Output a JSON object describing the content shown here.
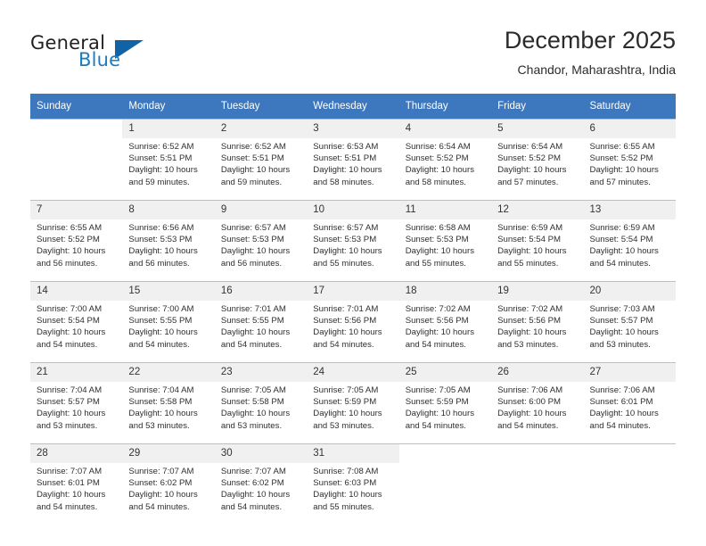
{
  "brand": {
    "name_top": "General",
    "name_bottom": "Blue",
    "accent_color": "#1263a5",
    "text_color": "#231f20"
  },
  "header": {
    "title": "December 2025",
    "location": "Chandor, Maharashtra, India"
  },
  "calendar": {
    "header_bg": "#3d78be",
    "daynum_bg": "#f0f0f0",
    "weekdays": [
      "Sunday",
      "Monday",
      "Tuesday",
      "Wednesday",
      "Thursday",
      "Friday",
      "Saturday"
    ],
    "weeks": [
      [
        {
          "day": "",
          "blank": true,
          "lines": []
        },
        {
          "day": "1",
          "lines": [
            "Sunrise: 6:52 AM",
            "Sunset: 5:51 PM",
            "Daylight: 10 hours",
            "and 59 minutes."
          ]
        },
        {
          "day": "2",
          "lines": [
            "Sunrise: 6:52 AM",
            "Sunset: 5:51 PM",
            "Daylight: 10 hours",
            "and 59 minutes."
          ]
        },
        {
          "day": "3",
          "lines": [
            "Sunrise: 6:53 AM",
            "Sunset: 5:51 PM",
            "Daylight: 10 hours",
            "and 58 minutes."
          ]
        },
        {
          "day": "4",
          "lines": [
            "Sunrise: 6:54 AM",
            "Sunset: 5:52 PM",
            "Daylight: 10 hours",
            "and 58 minutes."
          ]
        },
        {
          "day": "5",
          "lines": [
            "Sunrise: 6:54 AM",
            "Sunset: 5:52 PM",
            "Daylight: 10 hours",
            "and 57 minutes."
          ]
        },
        {
          "day": "6",
          "lines": [
            "Sunrise: 6:55 AM",
            "Sunset: 5:52 PM",
            "Daylight: 10 hours",
            "and 57 minutes."
          ]
        }
      ],
      [
        {
          "day": "7",
          "lines": [
            "Sunrise: 6:55 AM",
            "Sunset: 5:52 PM",
            "Daylight: 10 hours",
            "and 56 minutes."
          ]
        },
        {
          "day": "8",
          "lines": [
            "Sunrise: 6:56 AM",
            "Sunset: 5:53 PM",
            "Daylight: 10 hours",
            "and 56 minutes."
          ]
        },
        {
          "day": "9",
          "lines": [
            "Sunrise: 6:57 AM",
            "Sunset: 5:53 PM",
            "Daylight: 10 hours",
            "and 56 minutes."
          ]
        },
        {
          "day": "10",
          "lines": [
            "Sunrise: 6:57 AM",
            "Sunset: 5:53 PM",
            "Daylight: 10 hours",
            "and 55 minutes."
          ]
        },
        {
          "day": "11",
          "lines": [
            "Sunrise: 6:58 AM",
            "Sunset: 5:53 PM",
            "Daylight: 10 hours",
            "and 55 minutes."
          ]
        },
        {
          "day": "12",
          "lines": [
            "Sunrise: 6:59 AM",
            "Sunset: 5:54 PM",
            "Daylight: 10 hours",
            "and 55 minutes."
          ]
        },
        {
          "day": "13",
          "lines": [
            "Sunrise: 6:59 AM",
            "Sunset: 5:54 PM",
            "Daylight: 10 hours",
            "and 54 minutes."
          ]
        }
      ],
      [
        {
          "day": "14",
          "lines": [
            "Sunrise: 7:00 AM",
            "Sunset: 5:54 PM",
            "Daylight: 10 hours",
            "and 54 minutes."
          ]
        },
        {
          "day": "15",
          "lines": [
            "Sunrise: 7:00 AM",
            "Sunset: 5:55 PM",
            "Daylight: 10 hours",
            "and 54 minutes."
          ]
        },
        {
          "day": "16",
          "lines": [
            "Sunrise: 7:01 AM",
            "Sunset: 5:55 PM",
            "Daylight: 10 hours",
            "and 54 minutes."
          ]
        },
        {
          "day": "17",
          "lines": [
            "Sunrise: 7:01 AM",
            "Sunset: 5:56 PM",
            "Daylight: 10 hours",
            "and 54 minutes."
          ]
        },
        {
          "day": "18",
          "lines": [
            "Sunrise: 7:02 AM",
            "Sunset: 5:56 PM",
            "Daylight: 10 hours",
            "and 54 minutes."
          ]
        },
        {
          "day": "19",
          "lines": [
            "Sunrise: 7:02 AM",
            "Sunset: 5:56 PM",
            "Daylight: 10 hours",
            "and 53 minutes."
          ]
        },
        {
          "day": "20",
          "lines": [
            "Sunrise: 7:03 AM",
            "Sunset: 5:57 PM",
            "Daylight: 10 hours",
            "and 53 minutes."
          ]
        }
      ],
      [
        {
          "day": "21",
          "lines": [
            "Sunrise: 7:04 AM",
            "Sunset: 5:57 PM",
            "Daylight: 10 hours",
            "and 53 minutes."
          ]
        },
        {
          "day": "22",
          "lines": [
            "Sunrise: 7:04 AM",
            "Sunset: 5:58 PM",
            "Daylight: 10 hours",
            "and 53 minutes."
          ]
        },
        {
          "day": "23",
          "lines": [
            "Sunrise: 7:05 AM",
            "Sunset: 5:58 PM",
            "Daylight: 10 hours",
            "and 53 minutes."
          ]
        },
        {
          "day": "24",
          "lines": [
            "Sunrise: 7:05 AM",
            "Sunset: 5:59 PM",
            "Daylight: 10 hours",
            "and 53 minutes."
          ]
        },
        {
          "day": "25",
          "lines": [
            "Sunrise: 7:05 AM",
            "Sunset: 5:59 PM",
            "Daylight: 10 hours",
            "and 54 minutes."
          ]
        },
        {
          "day": "26",
          "lines": [
            "Sunrise: 7:06 AM",
            "Sunset: 6:00 PM",
            "Daylight: 10 hours",
            "and 54 minutes."
          ]
        },
        {
          "day": "27",
          "lines": [
            "Sunrise: 7:06 AM",
            "Sunset: 6:01 PM",
            "Daylight: 10 hours",
            "and 54 minutes."
          ]
        }
      ],
      [
        {
          "day": "28",
          "lines": [
            "Sunrise: 7:07 AM",
            "Sunset: 6:01 PM",
            "Daylight: 10 hours",
            "and 54 minutes."
          ]
        },
        {
          "day": "29",
          "lines": [
            "Sunrise: 7:07 AM",
            "Sunset: 6:02 PM",
            "Daylight: 10 hours",
            "and 54 minutes."
          ]
        },
        {
          "day": "30",
          "lines": [
            "Sunrise: 7:07 AM",
            "Sunset: 6:02 PM",
            "Daylight: 10 hours",
            "and 54 minutes."
          ]
        },
        {
          "day": "31",
          "lines": [
            "Sunrise: 7:08 AM",
            "Sunset: 6:03 PM",
            "Daylight: 10 hours",
            "and 55 minutes."
          ]
        },
        {
          "day": "",
          "blank": true,
          "lines": []
        },
        {
          "day": "",
          "blank": true,
          "lines": []
        },
        {
          "day": "",
          "blank": true,
          "lines": []
        }
      ]
    ]
  }
}
